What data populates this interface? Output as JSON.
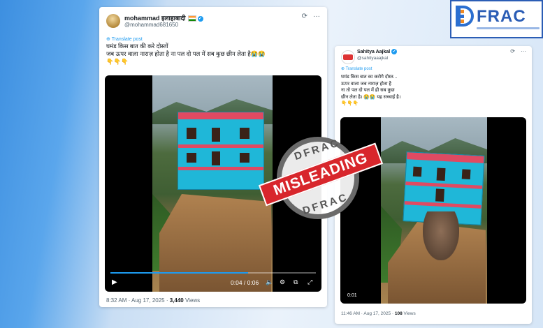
{
  "brand": {
    "name": "FRAC",
    "accent": "#2b5db5"
  },
  "stamp": {
    "top_word": "DFRAC",
    "label": "MISLEADING",
    "bottom_word": "DFRAC",
    "color": "#d8262c"
  },
  "post1": {
    "display_name": "mohammad इलाहाबादी",
    "handle": "@mohammad681650",
    "translate_label": "Translate post",
    "text": "घमंड किस बात की करे दोस्तों\nजब ऊपर वाला नाराज़ होता है ना पल दो पल में सब कुछ छीन लेता है😭😭\n👇👇👇",
    "video": {
      "time": "0:04 / 0:06",
      "progress": 0.67
    },
    "timestamp": "8:32 AM · Aug 17, 2025 · ",
    "views_count": "3,440",
    "views_label": " Views"
  },
  "post2": {
    "display_name": "Sahitya Aajkal",
    "handle": "@sahityaaajkal",
    "translate_label": "Translate post",
    "text": "घमंड किस बात का करोगे दोस्त...\nऊपर वाला जब नाराज़ होता है\nना तो पल दो पल में ही सब कुछ\nछीन लेता है। 😭😭 यह सच्चाई है।\n👇👇👇",
    "video": {
      "time": "0:01"
    },
    "timestamp": "11:46 AM · Aug 17, 2025 · ",
    "views_count": "108",
    "views_label": " Views"
  },
  "icons": [
    "grok-icon",
    "more-icon",
    "translate-icon",
    "verified-icon",
    "play-icon",
    "volume-icon",
    "settings-icon",
    "pip-icon",
    "fullscreen-icon"
  ]
}
